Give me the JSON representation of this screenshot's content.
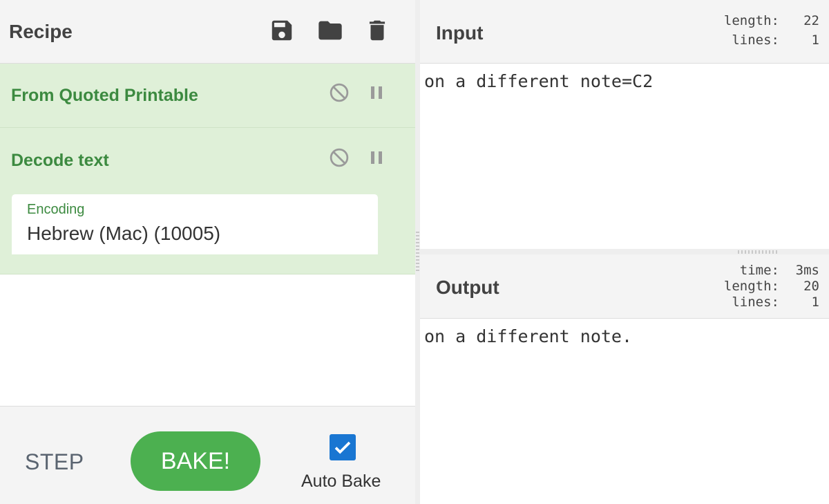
{
  "recipe": {
    "title": "Recipe",
    "icons": [
      "save-icon",
      "folder-icon",
      "trash-icon"
    ],
    "operations": [
      {
        "name": "From Quoted Printable"
      },
      {
        "name": "Decode text",
        "args": [
          {
            "label": "Encoding",
            "value": "Hebrew (Mac) (10005)"
          }
        ]
      }
    ],
    "controls": {
      "step": "STEP",
      "bake": "BAKE!",
      "auto_bake": "Auto Bake",
      "auto_bake_checked": true
    }
  },
  "input": {
    "title": "Input",
    "info": {
      "length_label": "length:",
      "length": "22",
      "lines_label": "lines:",
      "lines": "1"
    },
    "text": "on a different note=C2"
  },
  "output": {
    "title": "Output",
    "info": {
      "time_label": "time:",
      "time": "3ms",
      "length_label": "length:",
      "length": "20",
      "lines_label": "lines:",
      "lines": "1"
    },
    "text": "on a different note."
  },
  "colors": {
    "accent_green": "#4cb050",
    "op_bg": "#dff0d8",
    "op_text": "#3c8a40",
    "checkbox_blue": "#1976d2"
  }
}
